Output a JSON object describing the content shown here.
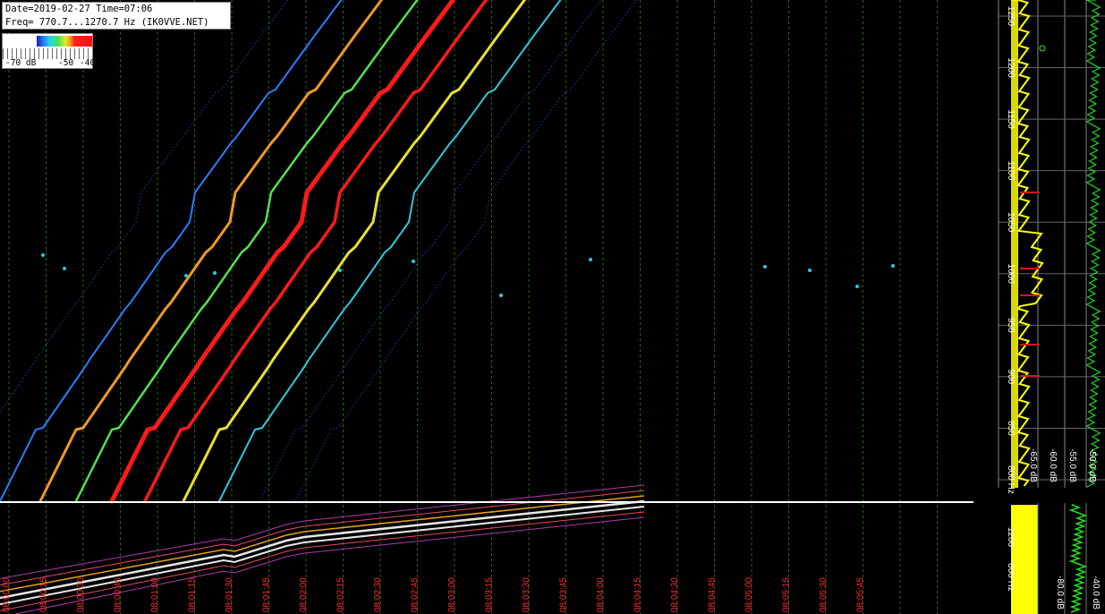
{
  "header": {
    "date_line": "Date=2019-02-27 Time=07:06",
    "freq_line": "Freq= 770.7...1270.7 Hz (IK0VVE.NET)"
  },
  "scale": {
    "labels": [
      "-70 dB",
      "-50",
      "-40"
    ]
  },
  "colors": {
    "background": "#000000",
    "grid_line": "#1f8f1f",
    "time_label": "#ff2a2a",
    "freq_label": "#ffffff",
    "spectrum_avg": "#ffff00",
    "spectrum_peak": "#d01818",
    "spectrum_right": "#22dd22"
  },
  "chart_data": {
    "type": "heatmap",
    "title": "",
    "freq_axis": {
      "ticks": [
        "1250",
        "1200",
        "1150",
        "1100",
        "1050",
        "1000",
        "950",
        "900",
        "850",
        "800 Hz"
      ],
      "range_hz": [
        770.7,
        1270.7
      ]
    },
    "time_axis": {
      "labels": [
        "08:00:00",
        "08:00:15",
        "08:00:30",
        "08:00:45",
        "08:01:00",
        "08:01:15",
        "08:01:30",
        "08:01:45",
        "08:02:00",
        "08:02:15",
        "08:02:30",
        "08:02:45",
        "08:03:00",
        "08:03:15",
        "08:03:30",
        "08:03:45",
        "08:04:00",
        "08:04:15",
        "08:04:30",
        "08:04:45",
        "08:05:00",
        "08:05:15",
        "08:05:30",
        "08:05:45"
      ]
    },
    "db_axis": {
      "labels": [
        "-65.0 dB",
        "-60.0 dB",
        "-55.0 dB",
        "-50.0 dB"
      ],
      "range_db": [
        -70,
        -40
      ]
    },
    "lower_panel": {
      "freq_ticks": [
        "1200",
        "800 Hz"
      ],
      "db_labels": [
        "-80.0 dB",
        "-40.0 dB"
      ]
    },
    "traces": [
      {
        "intensity": "blue"
      },
      {
        "intensity": "orange"
      },
      {
        "intensity": "green-yellow"
      },
      {
        "intensity": "red"
      },
      {
        "intensity": "red"
      },
      {
        "intensity": "yellow"
      },
      {
        "intensity": "cyan"
      }
    ]
  }
}
